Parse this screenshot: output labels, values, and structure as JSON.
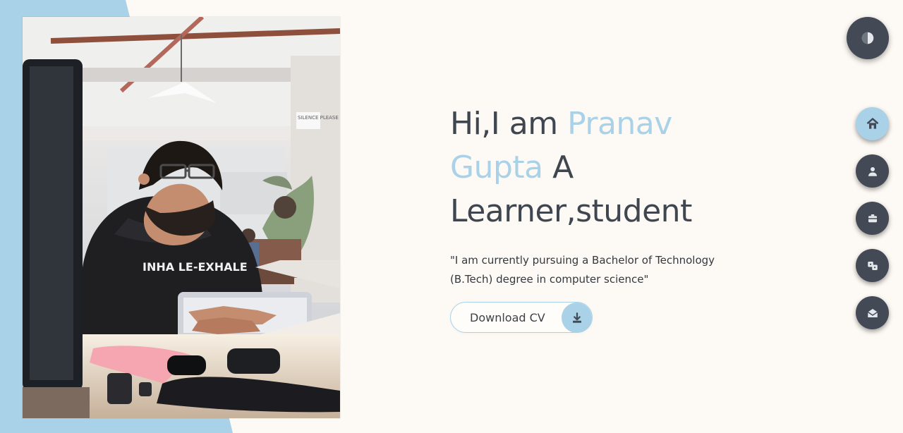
{
  "hero": {
    "greeting": "Hi,I am",
    "name_line1": "Pranav",
    "name_line2": "Gupta",
    "connector": "A",
    "role": "Learner,student",
    "description": "\"I am currently pursuing a Bachelor of Technology (B.Tech) degree in computer science\""
  },
  "actions": {
    "download_cv": "Download CV",
    "download_icon": "download-icon"
  },
  "photo": {
    "shirt_text": "INHA LE-EXHALE",
    "sign_text": "SILENCE PLEASE"
  },
  "nav": {
    "items": [
      {
        "icon": "home-icon",
        "active": true
      },
      {
        "icon": "user-icon",
        "active": false
      },
      {
        "icon": "briefcase-icon",
        "active": false
      },
      {
        "icon": "skills-icon",
        "active": false
      },
      {
        "icon": "mail-open-icon",
        "active": false
      }
    ]
  },
  "theme": {
    "toggle_icon": "theme-toggle-icon"
  },
  "colors": {
    "background": "#fdf9f4",
    "accent": "#a9d1e7",
    "dark": "#434a55",
    "text": "#3f4650"
  }
}
